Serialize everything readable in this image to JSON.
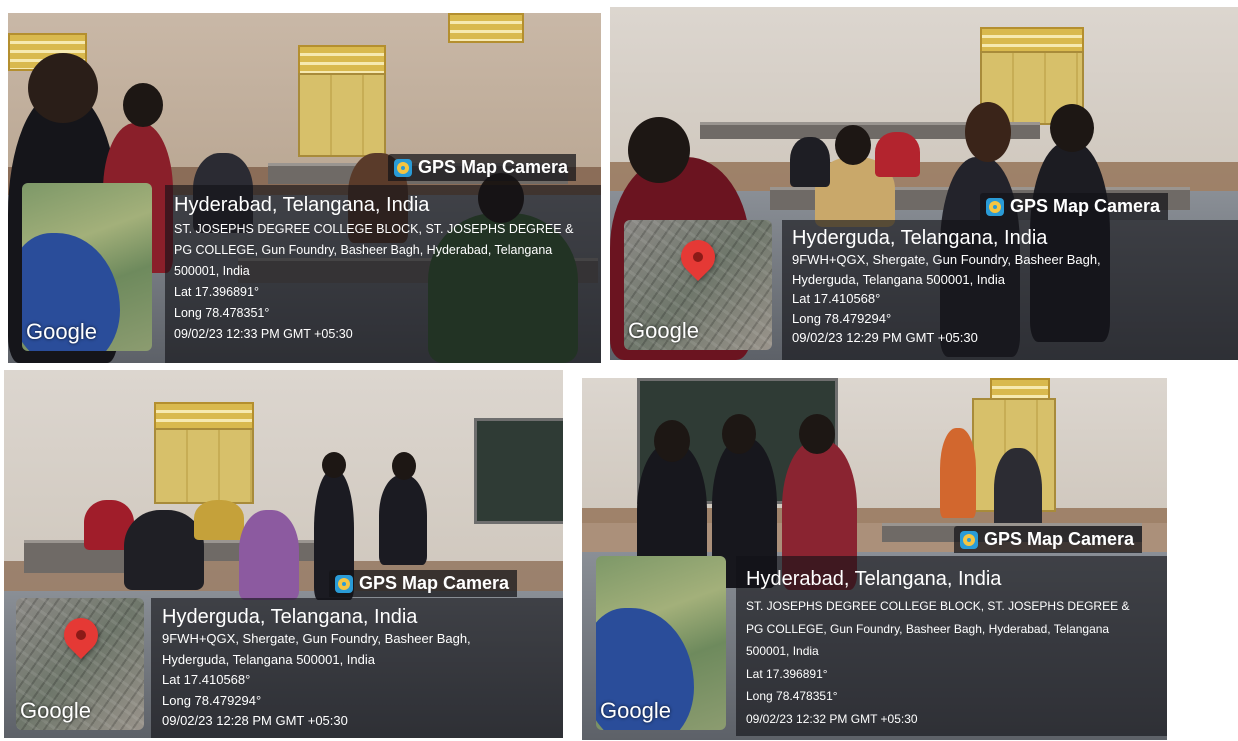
{
  "photos": [
    {
      "gps_label": "GPS Map Camera",
      "map_type": "satellite",
      "map_watermark": "Google",
      "place": "Hyderabad, Telangana, India",
      "address_lines": [
        "ST. JOSEPHS DEGREE COLLEGE BLOCK, ST. JOSEPHS DEGREE &",
        "PG COLLEGE, Gun Foundry, Basheer Bagh, Hyderabad, Telangana",
        "500001, India"
      ],
      "lat": "Lat 17.396891°",
      "long": "Long 78.478351°",
      "timestamp": "09/02/23 12:33 PM GMT +05:30"
    },
    {
      "gps_label": "GPS Map Camera",
      "map_type": "city-with-pin",
      "map_watermark": "Google",
      "place": "Hyderguda, Telangana, India",
      "address_lines": [
        "9FWH+QGX, Shergate, Gun Foundry, Basheer Bagh,",
        "Hyderguda, Telangana 500001, India"
      ],
      "lat": "Lat 17.410568°",
      "long": "Long 78.479294°",
      "timestamp": "09/02/23 12:29 PM GMT +05:30"
    },
    {
      "gps_label": "GPS Map Camera",
      "map_type": "city-with-pin",
      "map_watermark": "Google",
      "place": "Hyderguda, Telangana, India",
      "address_lines": [
        "9FWH+QGX, Shergate, Gun Foundry, Basheer Bagh,",
        "Hyderguda, Telangana 500001, India"
      ],
      "lat": "Lat 17.410568°",
      "long": "Long 78.479294°",
      "timestamp": "09/02/23 12:28 PM GMT +05:30"
    },
    {
      "gps_label": "GPS Map Camera",
      "map_type": "satellite",
      "map_watermark": "Google",
      "place": "Hyderabad, Telangana, India",
      "address_lines": [
        "ST. JOSEPHS DEGREE COLLEGE BLOCK, ST. JOSEPHS DEGREE &",
        "PG COLLEGE, Gun Foundry, Basheer Bagh, Hyderabad, Telangana",
        "500001, India"
      ],
      "lat": "Lat 17.396891°",
      "long": "Long 78.478351°",
      "timestamp": "09/02/23 12:32 PM GMT +05:30"
    }
  ],
  "colors": {
    "overlay": "#121216",
    "pin": "#e53935",
    "sea": "#2a4d9a"
  }
}
